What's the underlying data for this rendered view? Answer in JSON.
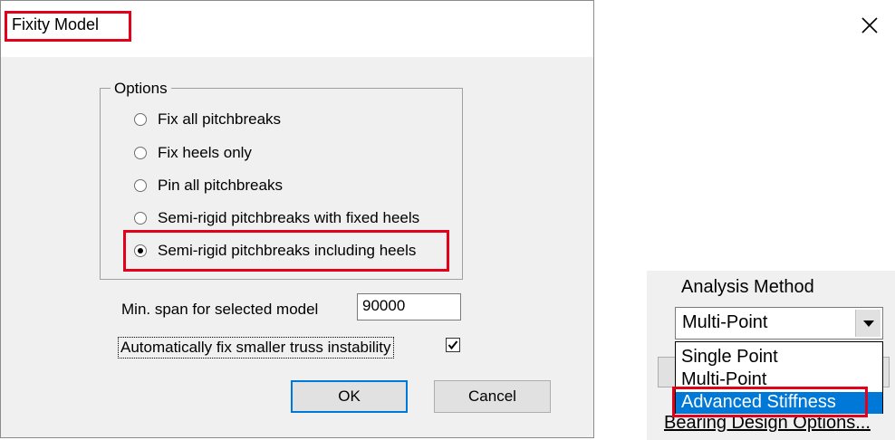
{
  "dialog": {
    "title": "Fixity Model",
    "options_legend": "Options",
    "options": [
      {
        "label": "Fix all pitchbreaks",
        "checked": false
      },
      {
        "label": "Fix heels only",
        "checked": false
      },
      {
        "label": "Pin all pitchbreaks",
        "checked": false
      },
      {
        "label": "Semi-rigid pitchbreaks with fixed heels",
        "checked": false
      },
      {
        "label": "Semi-rigid pitchbreaks including heels",
        "checked": true
      }
    ],
    "min_span_label": "Min. span for selected model",
    "min_span_value": "90000",
    "auto_fix_label": "Automatically fix smaller truss instability",
    "auto_fix_checked": true,
    "ok_label": "OK",
    "cancel_label": "Cancel"
  },
  "analysis": {
    "label": "Analysis Method",
    "selected": "Multi-Point",
    "options": [
      "Single Point",
      "Multi-Point",
      "Advanced Stiffness"
    ],
    "highlighted": "Advanced Stiffness",
    "bearing_label": "Bearing Design Options..."
  },
  "colors": {
    "highlight_box": "#e2001a",
    "selection": "#0078d7"
  }
}
